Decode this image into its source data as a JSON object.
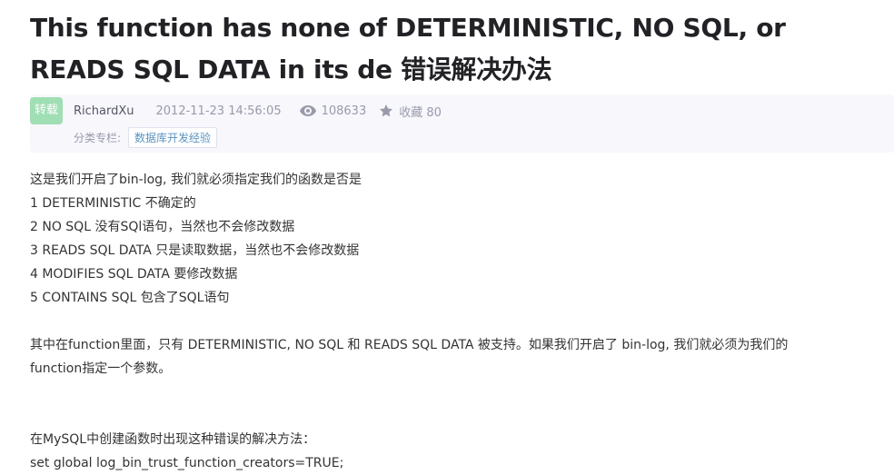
{
  "article": {
    "title": "This function has none of DETERMINISTIC, NO SQL, or READS SQL DATA in its de 错误解决办法",
    "badge": "转载",
    "author": "RichardXu",
    "date": "2012-11-23 14:56:05",
    "views": "108633",
    "favorites": "收藏 80",
    "category_label": "分类专栏:",
    "category": "数据库开发经验"
  },
  "body": {
    "line1": "这是我们开启了bin-log, 我们就必须指定我们的函数是否是",
    "line2": "1 DETERMINISTIC 不确定的",
    "line3": "2 NO SQL 没有SQl语句，当然也不会修改数据",
    "line4": "3 READS SQL DATA 只是读取数据，当然也不会修改数据",
    "line5": "4 MODIFIES SQL DATA 要修改数据",
    "line6": "5 CONTAINS SQL 包含了SQL语句",
    "para2_a": "其中在function里面，只有 DETERMINISTIC, NO SQL 和 READS SQL DATA 被支持。如果我们开启了 bin-log, 我们就必须为我们的",
    "para2_b": "function指定一个参数。",
    "para3": "在MySQL中创建函数时出现这种错误的解决方法：",
    "code": "set global log_bin_trust_function_creators=TRUE;"
  },
  "icons": {
    "views": "eye-icon",
    "favorites": "star-icon"
  },
  "colors": {
    "badge_bg": "#a0deb4",
    "meta_bg": "#f7f7fc",
    "category_link": "#5893c2"
  }
}
